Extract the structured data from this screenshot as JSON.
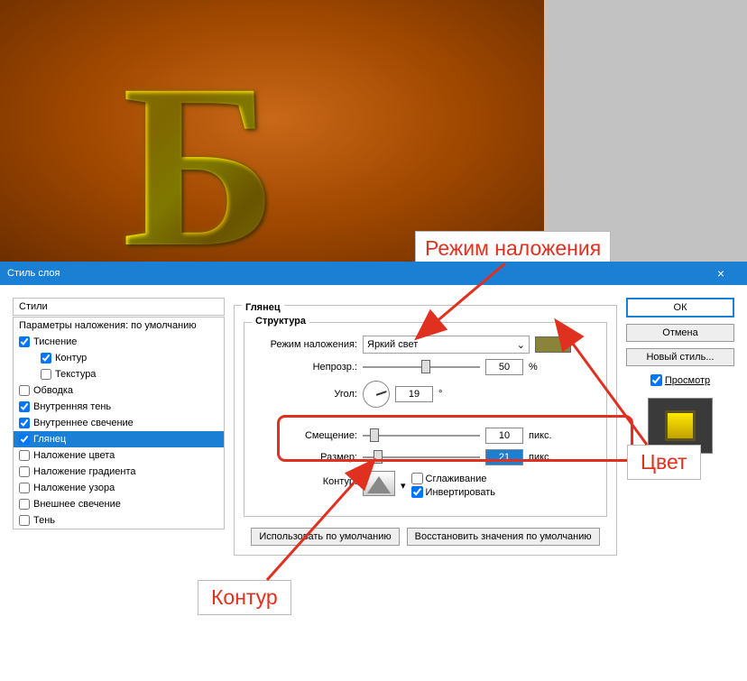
{
  "titlebar": {
    "title": "Стиль слоя"
  },
  "stylesHeader": "Стили",
  "blendDefaultsRow": "Параметры наложения: по умолчанию",
  "rows": [
    {
      "label": "Тиснение",
      "checked": true,
      "indent": false
    },
    {
      "label": "Контур",
      "checked": true,
      "indent": true
    },
    {
      "label": "Текстура",
      "checked": false,
      "indent": true
    },
    {
      "label": "Обводка",
      "checked": false,
      "indent": false
    },
    {
      "label": "Внутренняя тень",
      "checked": true,
      "indent": false
    },
    {
      "label": "Внутреннее свечение",
      "checked": true,
      "indent": false
    },
    {
      "label": "Глянец",
      "checked": true,
      "indent": false,
      "selected": true
    },
    {
      "label": "Наложение цвета",
      "checked": false,
      "indent": false
    },
    {
      "label": "Наложение градиента",
      "checked": false,
      "indent": false
    },
    {
      "label": "Наложение узора",
      "checked": false,
      "indent": false
    },
    {
      "label": "Внешнее свечение",
      "checked": false,
      "indent": false
    },
    {
      "label": "Тень",
      "checked": false,
      "indent": false
    }
  ],
  "section": {
    "title": "Глянец",
    "subtitle": "Структура"
  },
  "fields": {
    "blendMode": {
      "label": "Режим наложения:",
      "value": "Яркий свет"
    },
    "opacity": {
      "label": "Непрозр.:",
      "value": "50",
      "unit": "%",
      "thumb": 50
    },
    "angle": {
      "label": "Угол:",
      "value": "19",
      "unit": "°"
    },
    "distance": {
      "label": "Смещение:",
      "value": "10",
      "unit": "пикс.",
      "thumb": 6
    },
    "size": {
      "label": "Размер:",
      "value": "21",
      "unit": "пикс.",
      "thumb": 9
    },
    "contour": {
      "label": "Контур:"
    },
    "antialias": {
      "label": "Сглаживание",
      "checked": false
    },
    "invert": {
      "label": "Инвертировать",
      "checked": true
    }
  },
  "buttons": {
    "default": "Использовать по умолчанию",
    "reset": "Восстановить значения по умолчанию",
    "ok": "ОК",
    "cancel": "Отмена",
    "newstyle": "Новый стиль...",
    "preview": "Просмотр"
  },
  "callouts": {
    "blendMode": "Режим наложения",
    "color": "Цвет",
    "contour": "Контур"
  },
  "annotations": {
    "arrows_point_to": [
      "blend-mode-select",
      "color-swatch",
      "contour-preview"
    ],
    "red_box_around": [
      "distance-row",
      "size-row"
    ]
  }
}
